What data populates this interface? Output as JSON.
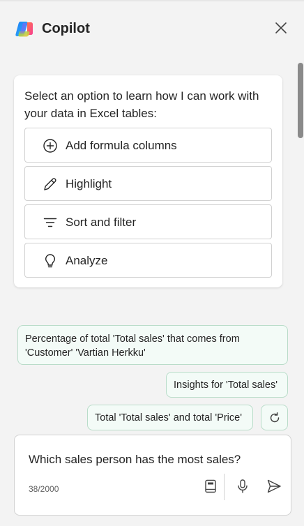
{
  "header": {
    "title": "Copilot",
    "logo_icon": "copilot-logo-icon",
    "close_icon": "close-icon"
  },
  "card": {
    "intro": "Select an option to learn how I can work with your data in Excel tables:",
    "options": [
      {
        "label": "Add formula columns",
        "icon": "add-circle-icon"
      },
      {
        "label": "Highlight",
        "icon": "pen-icon"
      },
      {
        "label": "Sort and filter",
        "icon": "filter-icon"
      },
      {
        "label": "Analyze",
        "icon": "lightbulb-icon"
      }
    ]
  },
  "suggestions": [
    {
      "line1": "Percentage of total 'Total sales' that comes from",
      "line2": "'Customer' 'Vartian Herkku'"
    },
    {
      "text": "Insights for 'Total sales'"
    },
    {
      "text": "Total 'Total sales' and total 'Price'"
    }
  ],
  "refresh_icon": "refresh-icon",
  "composer": {
    "text": "Which sales person has the most sales?",
    "char_count": "38/2000",
    "tools": [
      "prompt-guide-icon",
      "microphone-icon",
      "send-icon"
    ]
  },
  "colors": {
    "accent_chip_bg": "#f3fbf7",
    "accent_chip_border": "#b9dcc9",
    "background": "#f3f3f3"
  }
}
